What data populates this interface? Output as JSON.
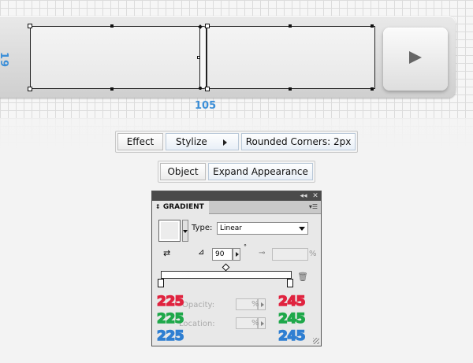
{
  "canvas": {
    "dimension_height": "19",
    "dimension_width": "105"
  },
  "menu_path_1": {
    "items": [
      "Effect",
      "Stylize",
      "Rounded Corners: 2px"
    ]
  },
  "menu_path_2": {
    "items": [
      "Object",
      "Expand Appearance"
    ]
  },
  "gradient_panel": {
    "title": "GRADIENT",
    "type_label": "Type:",
    "type_value": "Linear",
    "angle_value": "90",
    "degree_symbol": "°",
    "percent": "%",
    "opacity_label": "Opacity:",
    "location_label": "Location:",
    "left_rgb": [
      "225",
      "225",
      "225"
    ],
    "right_rgb": [
      "245",
      "245",
      "245"
    ]
  },
  "colors": {
    "red": "#e0233f",
    "green": "#1fa84a",
    "blue": "#2f7fd2",
    "dimension": "#3c8fd8"
  }
}
